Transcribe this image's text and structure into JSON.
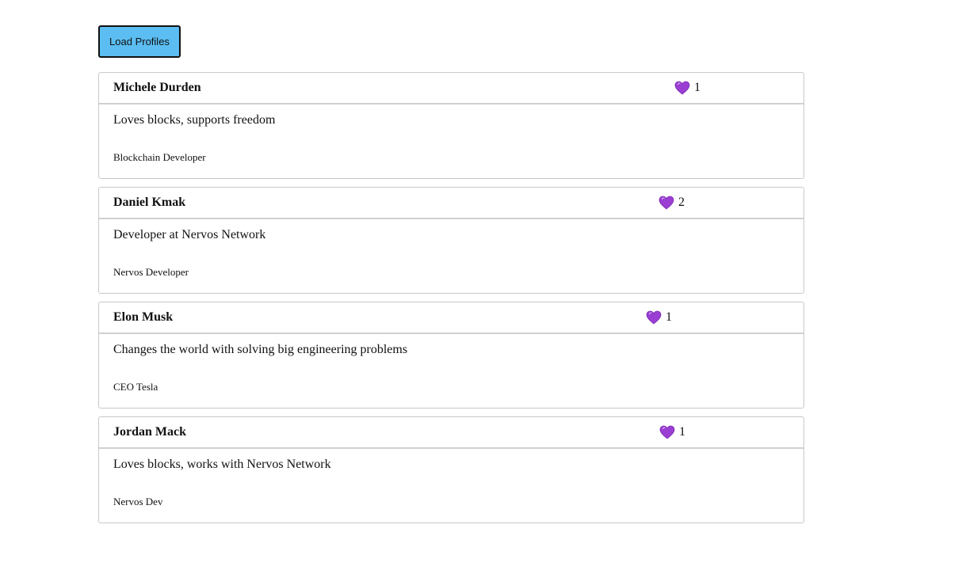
{
  "toolbar": {
    "load_label": "Load Profiles"
  },
  "accent_color": "#5bbdf2",
  "heart_color": "#9b3fd4",
  "heart_icon": "purple-heart-icon",
  "profiles": [
    {
      "name": "Michele Durden",
      "likes": "1",
      "bio": "Loves blocks, supports freedom",
      "role": "Blockchain Developer"
    },
    {
      "name": "Daniel Kmak",
      "likes": "2",
      "bio": "Developer at Nervos Network",
      "role": "Nervos Developer"
    },
    {
      "name": "Elon Musk",
      "likes": "1",
      "bio": "Changes the world with solving big engineering problems",
      "role": "CEO Tesla"
    },
    {
      "name": "Jordan Mack",
      "likes": "1",
      "bio": "Loves blocks, works with Nervos Network",
      "role": "Nervos Dev"
    }
  ]
}
